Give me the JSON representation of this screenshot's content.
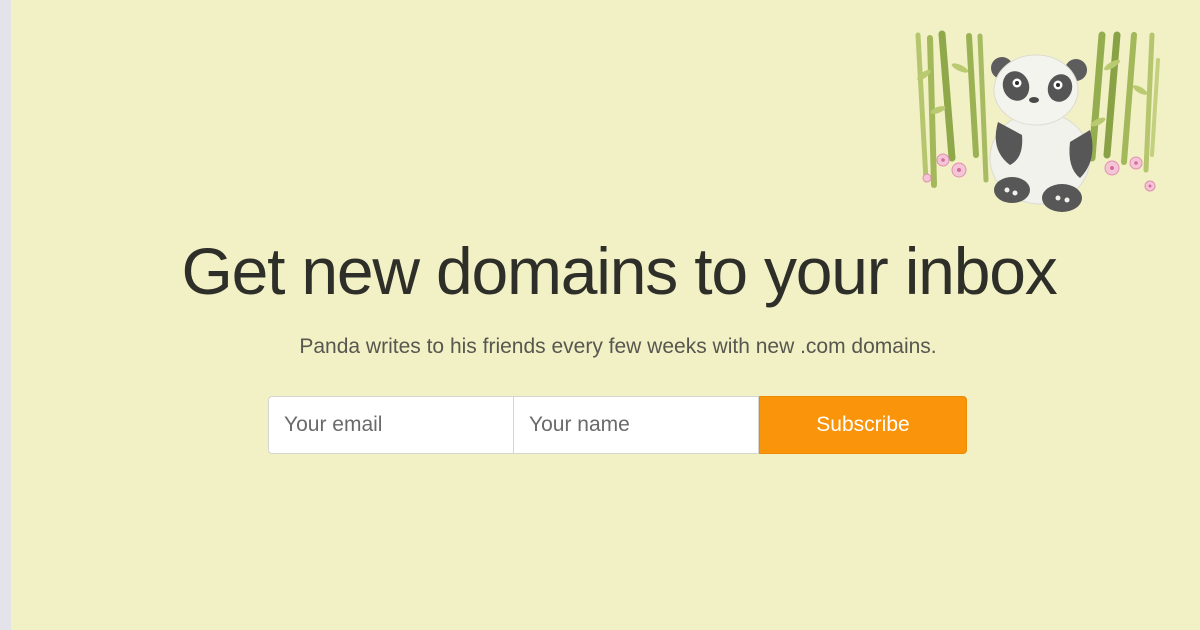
{
  "hero": {
    "headline": "Get new domains to your inbox",
    "subtitle": "Panda writes to his friends every few weeks with new .com domains."
  },
  "form": {
    "email_placeholder": "Your email",
    "name_placeholder": "Your name",
    "subscribe_label": "Subscribe"
  },
  "illustration": {
    "icon": "panda-with-bamboo-icon"
  },
  "colors": {
    "background": "#f2f0c5",
    "accent": "#fa940a",
    "heading_text": "#2f2f2a",
    "body_text": "#57574f"
  }
}
